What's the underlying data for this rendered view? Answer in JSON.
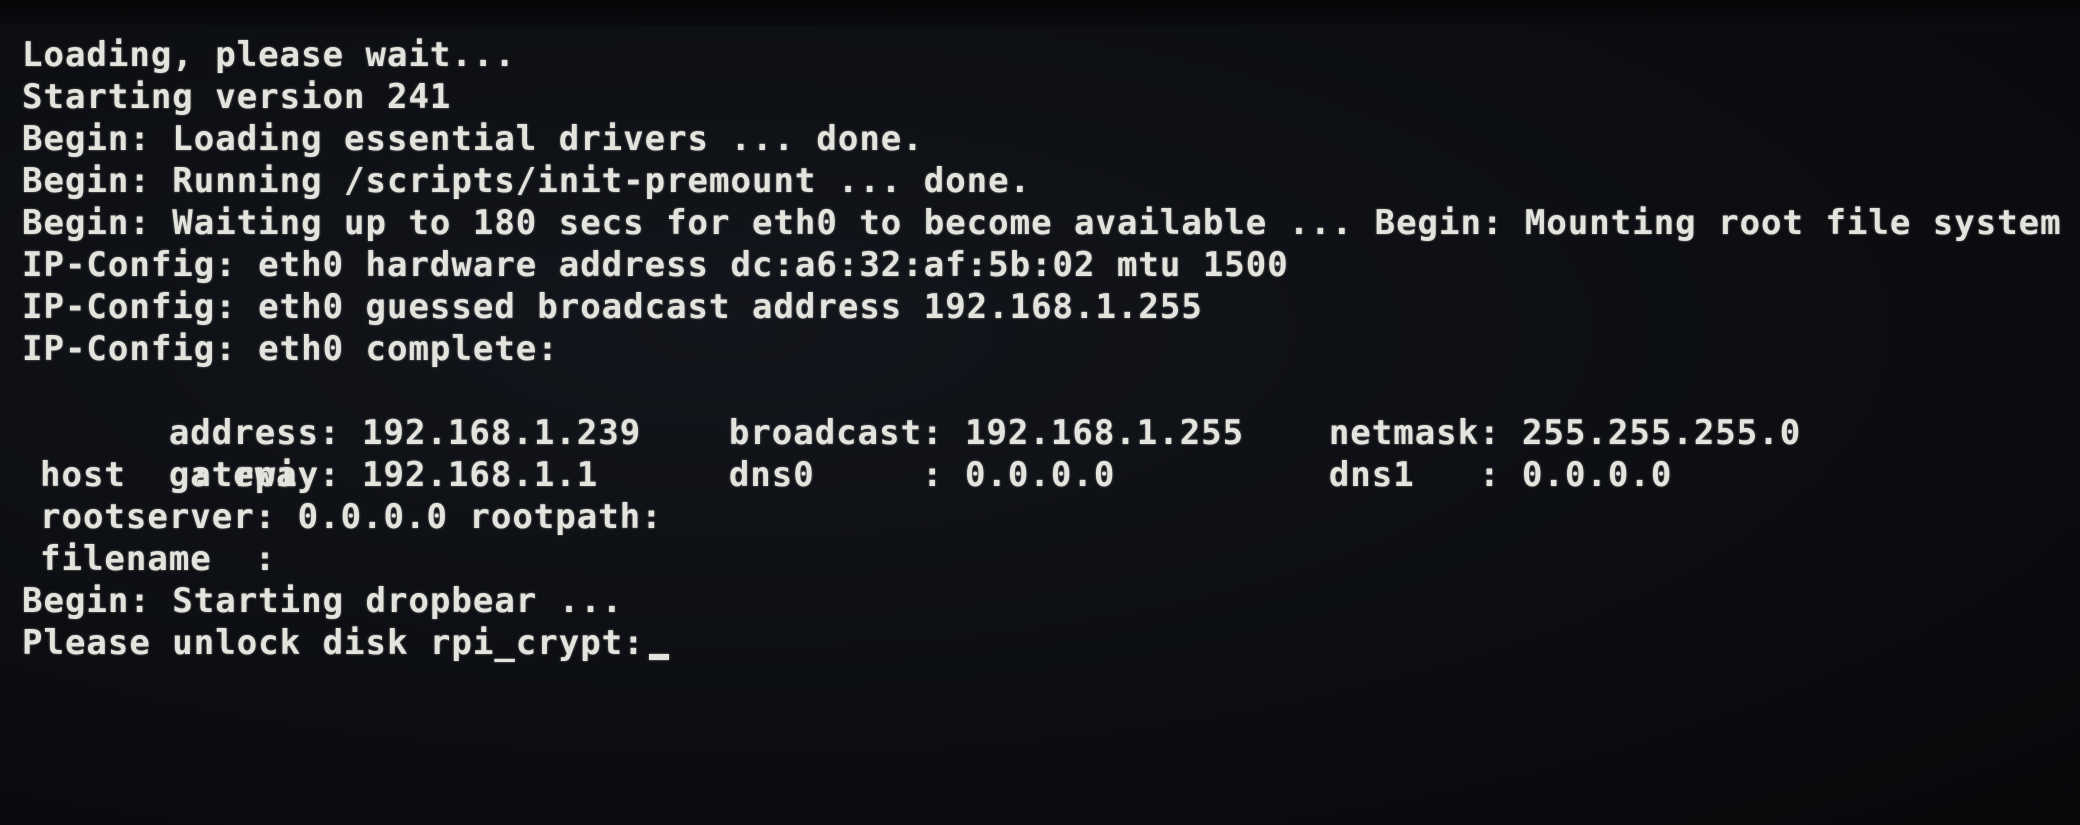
{
  "console": {
    "lines": [
      "Loading, please wait...",
      "Starting version 241",
      "Begin: Loading essential drivers ... done.",
      "Begin: Running /scripts/init-premount ... done.",
      "Begin: Waiting up to 180 secs for eth0 to become available ... Begin: Mounting root file system",
      "IP-Config: eth0 hardware address dc:a6:32:af:5b:02 mtu 1500",
      "IP-Config: eth0 guessed broadcast address 192.168.1.255",
      "IP-Config: eth0 complete:"
    ],
    "net": {
      "address": "address: 192.168.1.239",
      "broadcast": "broadcast: 192.168.1.255",
      "netmask": "netmask: 255.255.255.0",
      "gateway": "gateway: 192.168.1.1",
      "dns0": "dns0     : 0.0.0.0",
      "dns1": "dns1   : 0.0.0.0",
      "host": "host   : rpi",
      "rootserver": "rootserver: 0.0.0.0 rootpath:",
      "filename": "filename  :"
    },
    "dropbear": "Begin: Starting dropbear ...",
    "prompt": "Please unlock disk rpi_crypt:"
  }
}
